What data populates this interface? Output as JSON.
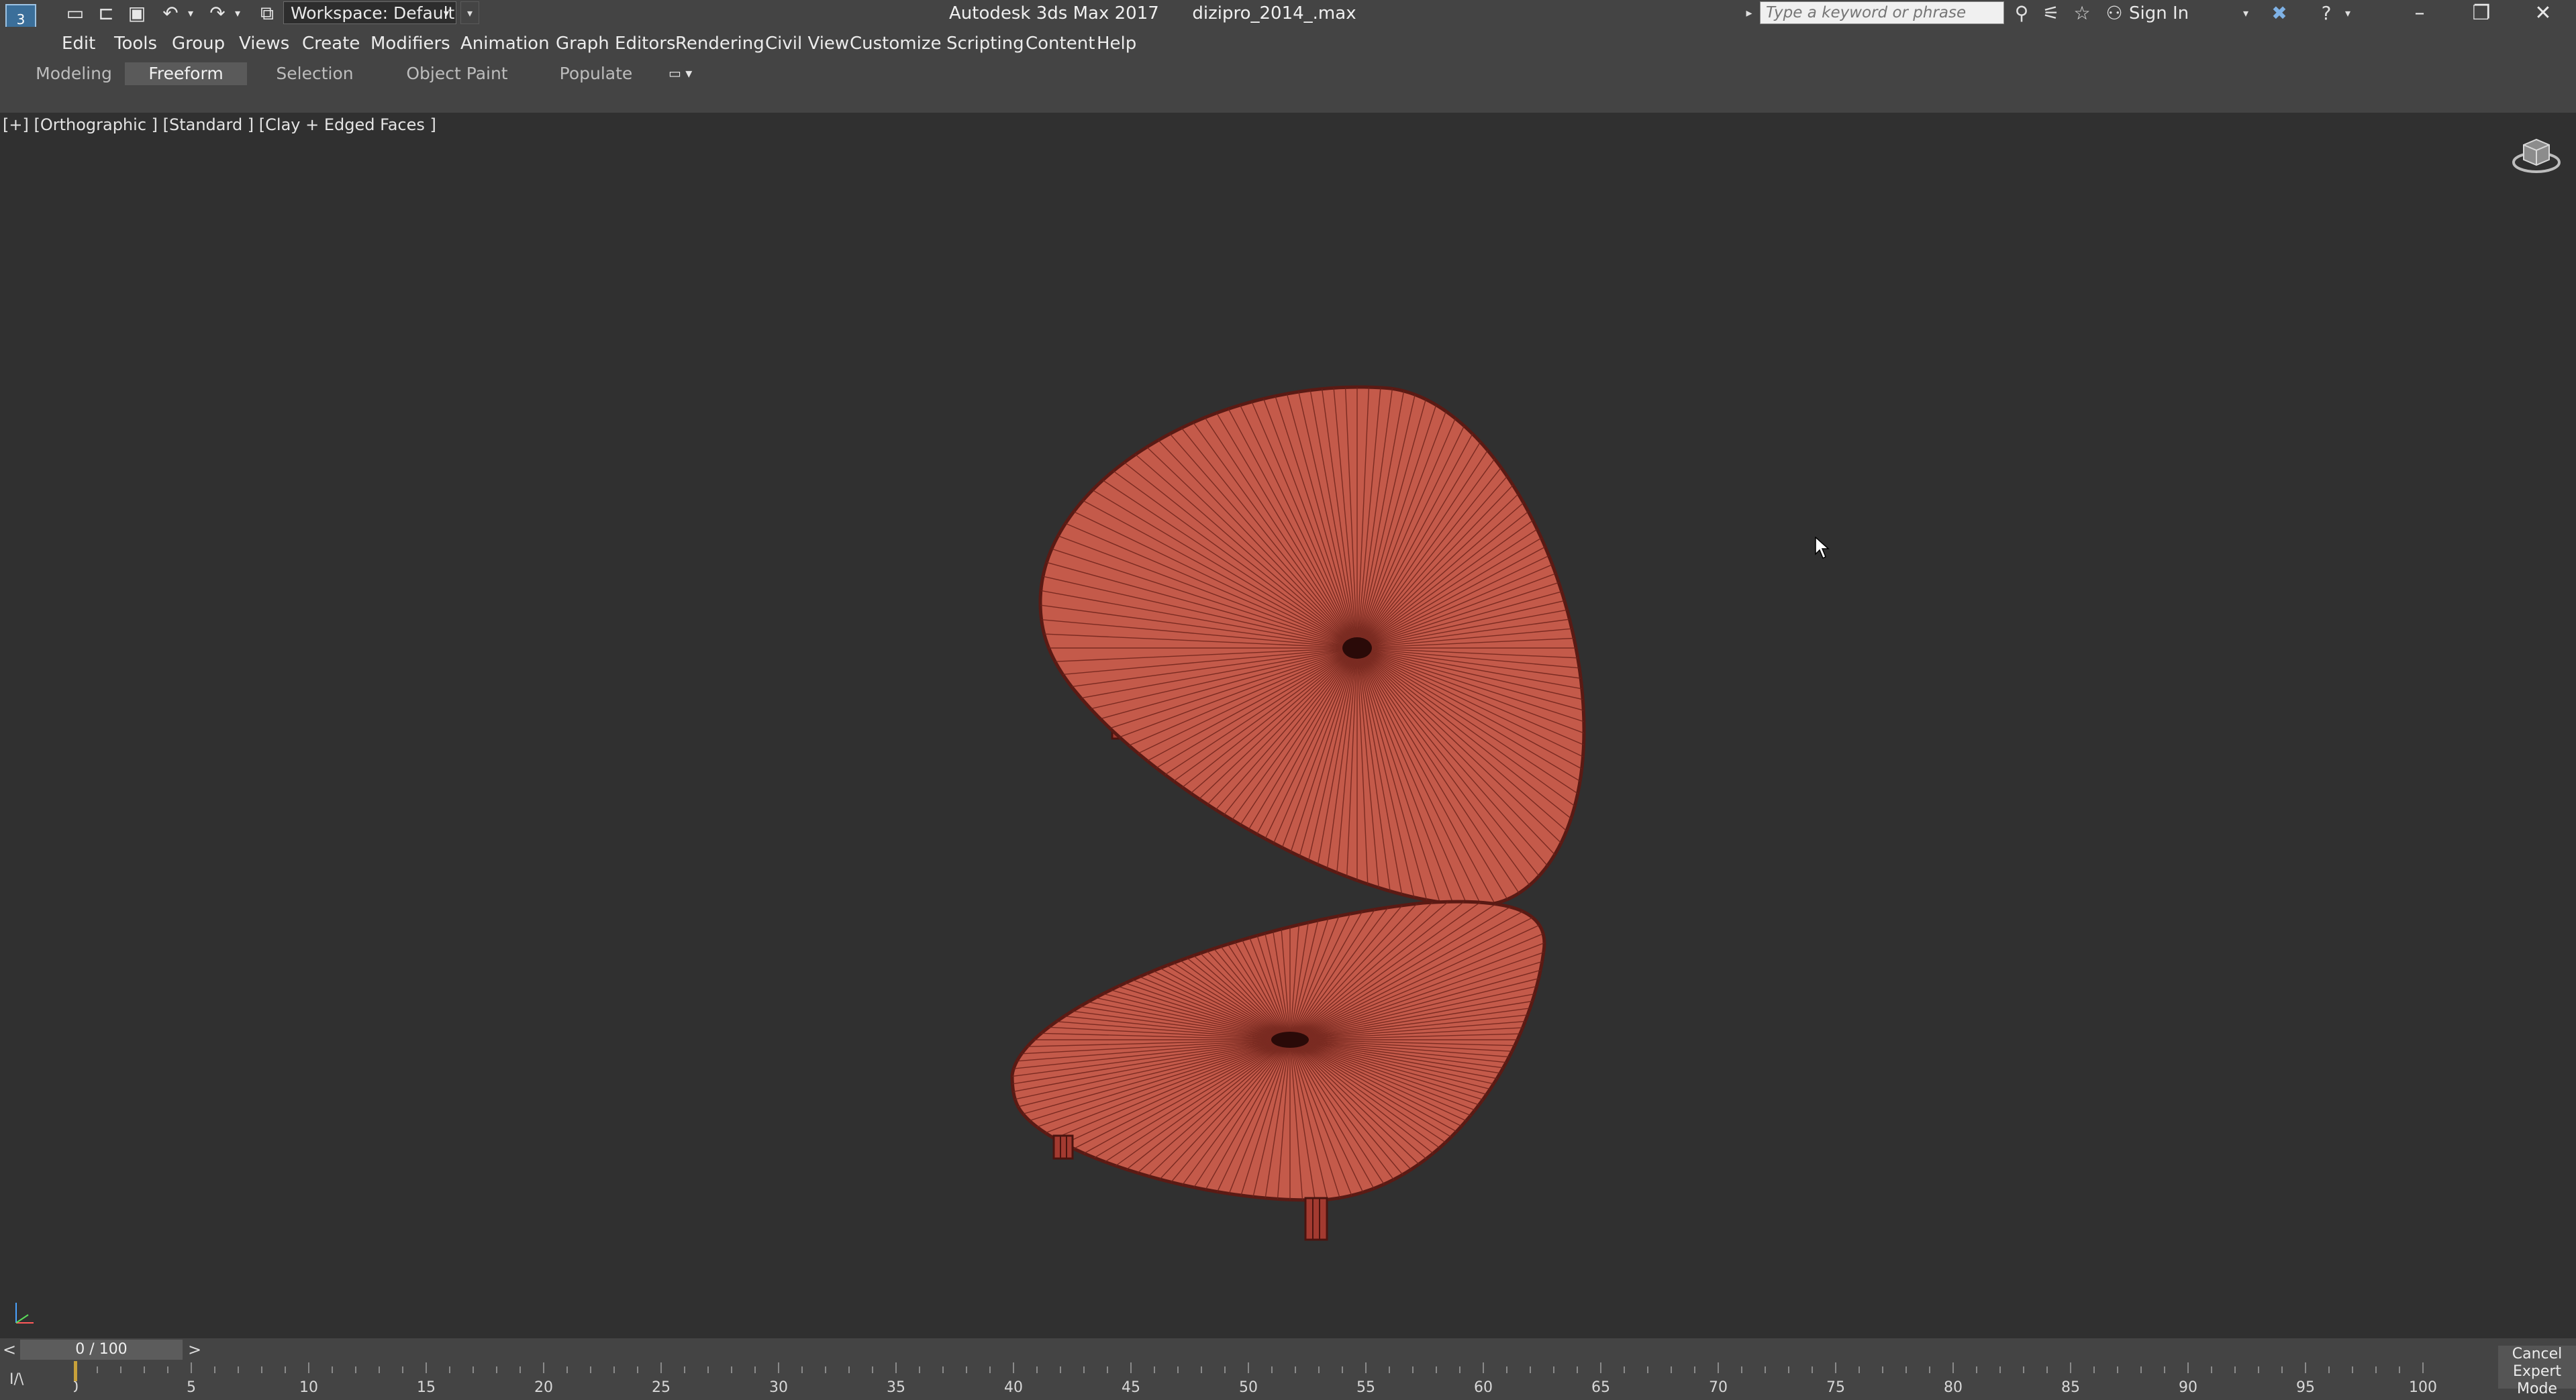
{
  "titlebar": {
    "app_name": "Autodesk 3ds Max 2017",
    "file_name": "dizipro_2014_.max",
    "workspace_label": "Workspace: Default",
    "search_placeholder": "Type a keyword or phrase",
    "sign_in_label": "Sign In",
    "quick_access_icons": [
      "new-file-icon",
      "open-file-icon",
      "save-icon",
      "undo-icon",
      "redo-icon",
      "project-folder-icon"
    ],
    "info_icons": [
      "binoculars-icon",
      "satellite-icon",
      "star-icon",
      "user-icon",
      "x-exchange-icon",
      "help-icon"
    ],
    "window_buttons": [
      "minimize-icon",
      "restore-icon",
      "close-icon"
    ]
  },
  "menu": {
    "items": [
      "Edit",
      "Tools",
      "Group",
      "Views",
      "Create",
      "Modifiers",
      "Animation",
      "Graph Editors",
      "Rendering",
      "Civil View",
      "Customize",
      "Scripting",
      "Content",
      "Help"
    ]
  },
  "ribbon": {
    "tabs": [
      "Modeling",
      "Freeform",
      "Selection",
      "Object Paint",
      "Populate"
    ],
    "active_tab": "Freeform"
  },
  "viewport": {
    "label": "[+] [Orthographic ] [Standard ] [Clay + Edged Faces ]",
    "object_color": "#c45a4a",
    "edge_color": "#5a1a14"
  },
  "timeline": {
    "frame_display": "0 / 100",
    "prev_symbol": "<",
    "next_symbol": ">",
    "ticks": [
      "0",
      "5",
      "10",
      "15",
      "20",
      "25",
      "30",
      "35",
      "40",
      "45",
      "50",
      "55",
      "60",
      "65",
      "70",
      "75",
      "80",
      "85",
      "90",
      "95",
      "100"
    ],
    "current_frame": 0,
    "mini_curve_label": "I/\\",
    "cancel_expert_line1": "Cancel",
    "cancel_expert_line2": "Expert Mode"
  },
  "colors": {
    "ui_dark": "#444444",
    "viewport_bg": "#303030",
    "accent_gold": "#c8a13a"
  }
}
